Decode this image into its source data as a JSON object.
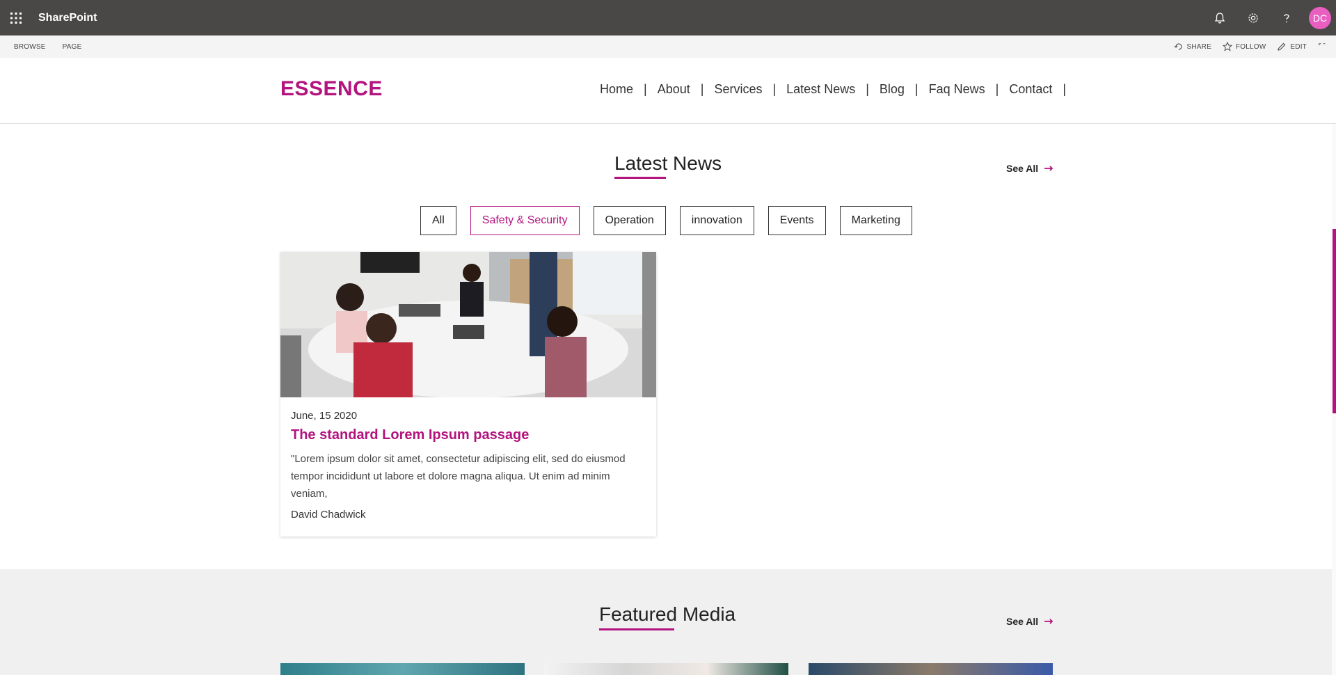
{
  "suitebar": {
    "app_name": "SharePoint",
    "icons": [
      "waffle-icon",
      "bell-icon",
      "gear-icon",
      "help-icon"
    ],
    "avatar_initials": "DC",
    "avatar_color": "#e85fc0",
    "background": "#4a4846"
  },
  "ribbon": {
    "tabs": [
      "BROWSE",
      "PAGE"
    ],
    "actions": [
      {
        "label": "SHARE",
        "icon": "share-icon"
      },
      {
        "label": "FOLLOW",
        "icon": "star-icon"
      },
      {
        "label": "EDIT",
        "icon": "pencil-icon"
      }
    ]
  },
  "site": {
    "logo": "ESSENCE",
    "accent_color": "#b3137e",
    "nav": [
      "Home",
      "About",
      "Services",
      "Latest News",
      "Blog",
      "Faq News",
      "Contact"
    ]
  },
  "latest_news": {
    "title_part1": "Latest",
    "title_part2": " News",
    "see_all": "See All",
    "filters": [
      "All",
      "Safety & Security",
      "Operation",
      "innovation",
      "Events",
      "Marketing"
    ],
    "active_filter": "Safety & Security",
    "card": {
      "date": "June, 15 2020",
      "title": "The standard Lorem Ipsum passage",
      "excerpt": "\"Lorem ipsum dolor sit amet, consectetur adipiscing elit, sed do eiusmod tempor incididunt ut labore et dolore magna aliqua. Ut enim ad minim veniam,",
      "author": "David Chadwick",
      "image_alt": "meeting-photo"
    }
  },
  "featured_media": {
    "title_part1": "Featured",
    "title_part2": " Media",
    "see_all": "See All"
  }
}
